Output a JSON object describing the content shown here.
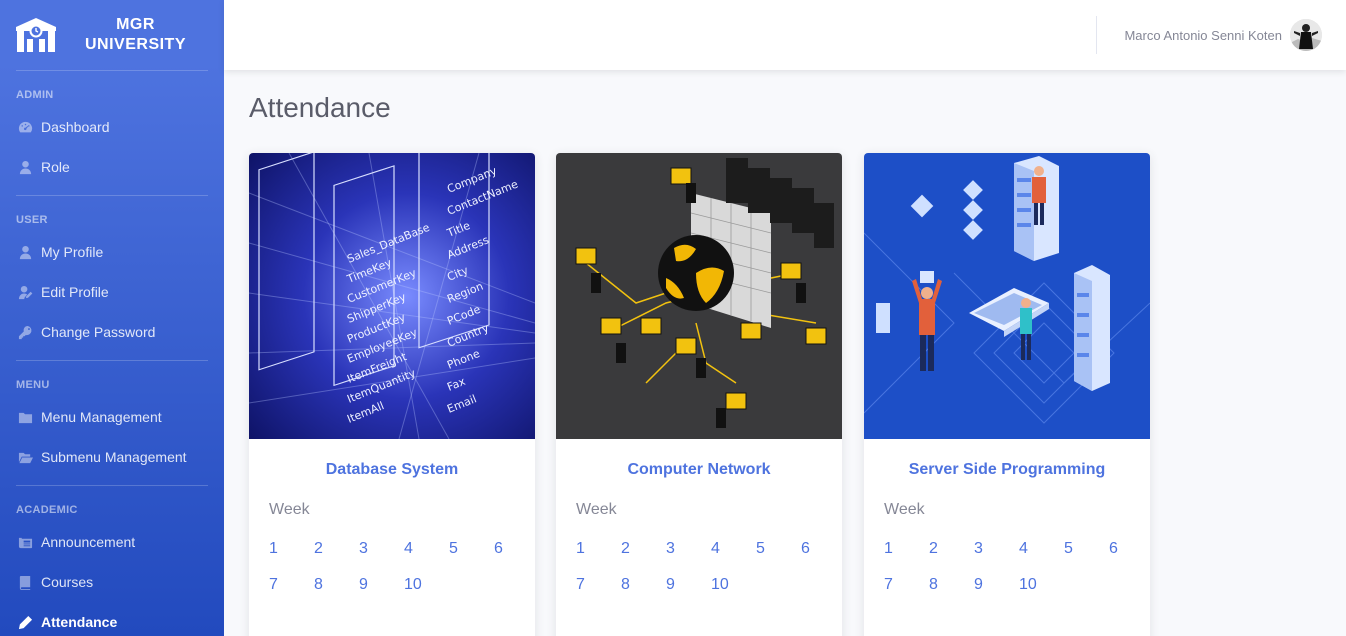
{
  "brand": {
    "line1": "MGR",
    "line2": "UNIVERSITY",
    "icon": "university-icon"
  },
  "sidebar": {
    "sections": [
      {
        "heading": "ADMIN",
        "items": [
          {
            "label": "Dashboard",
            "icon": "tachometer-icon"
          },
          {
            "label": "Role",
            "icon": "user-tie-icon"
          }
        ]
      },
      {
        "heading": "USER",
        "items": [
          {
            "label": "My Profile",
            "icon": "user-icon"
          },
          {
            "label": "Edit Profile",
            "icon": "user-edit-icon"
          },
          {
            "label": "Change Password",
            "icon": "key-icon"
          }
        ]
      },
      {
        "heading": "MENU",
        "items": [
          {
            "label": "Menu Management",
            "icon": "folder-icon"
          },
          {
            "label": "Submenu Management",
            "icon": "folder-open-icon"
          }
        ]
      },
      {
        "heading": "ACADEMIC",
        "items": [
          {
            "label": "Announcement",
            "icon": "newspaper-icon"
          },
          {
            "label": "Courses",
            "icon": "book-icon"
          },
          {
            "label": "Attendance",
            "icon": "pen-icon"
          }
        ]
      }
    ]
  },
  "topbar": {
    "user_name": "Marco Antonio Senni Koten"
  },
  "page": {
    "title": "Attendance"
  },
  "cards": [
    {
      "title": "Database System",
      "week_label": "Week",
      "weeks": [
        "1",
        "2",
        "3",
        "4",
        "5",
        "6",
        "7",
        "8",
        "9",
        "10"
      ]
    },
    {
      "title": "Computer Network",
      "week_label": "Week",
      "weeks": [
        "1",
        "2",
        "3",
        "4",
        "5",
        "6",
        "7",
        "8",
        "9",
        "10"
      ]
    },
    {
      "title": "Server Side Programming",
      "week_label": "Week",
      "weeks": [
        "1",
        "2",
        "3",
        "4",
        "5",
        "6",
        "7",
        "8",
        "9",
        "10"
      ]
    }
  ],
  "colors": {
    "primary": "#4e73df",
    "sidebar_dark": "#224abe",
    "background": "#f8f9fc"
  }
}
